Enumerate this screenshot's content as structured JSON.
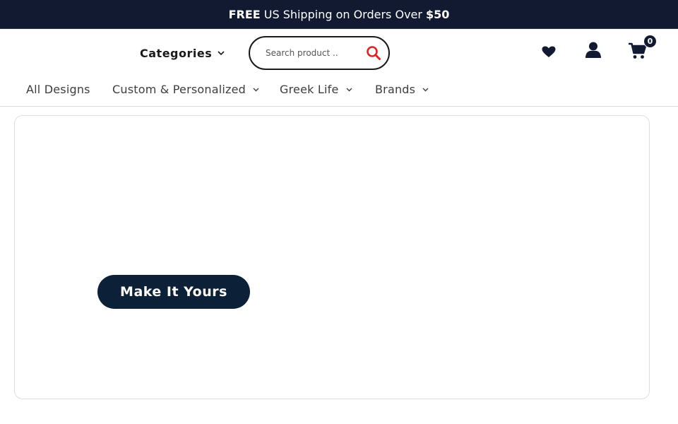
{
  "promo": {
    "free": "FREE",
    "middle": "US Shipping on Orders Over",
    "amount": "$50"
  },
  "header": {
    "categories_label": "Categories",
    "search_placeholder": "Search product ..",
    "search_icon": "search-icon",
    "wishlist_icon": "heart-icon",
    "account_icon": "user-icon",
    "cart_icon": "cart-icon",
    "cart_count": "0"
  },
  "nav": {
    "items": [
      {
        "label": "All Designs",
        "has_dropdown": false
      },
      {
        "label": "Custom & Personalized",
        "has_dropdown": true
      },
      {
        "label": "Greek Life",
        "has_dropdown": true
      },
      {
        "label": "Brands",
        "has_dropdown": true
      }
    ]
  },
  "hero": {
    "cta_label": "Make It Yours"
  },
  "colors": {
    "promo_bg": "#121a31",
    "search_icon": "#e02424",
    "cta_bg": "#0c2138",
    "icon_dark": "#121a31"
  }
}
